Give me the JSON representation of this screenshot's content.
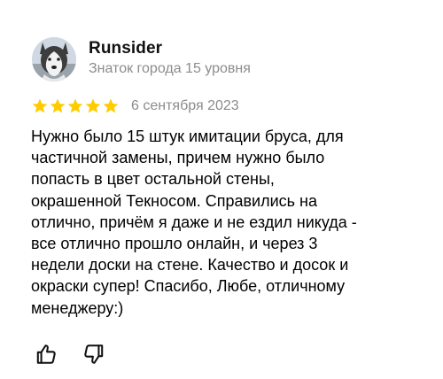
{
  "review": {
    "author": {
      "name": "Runsider",
      "level": "Знаток города 15 уровня",
      "avatar_icon": "husky-dog-avatar"
    },
    "rating": {
      "stars": 5,
      "max": 5,
      "star_color": "#ffcc00"
    },
    "date": "6 сентября 2023",
    "text": "Нужно было 15 штук имитации бруса, для\nчастичной замены, причем нужно было\nпопасть в цвет остальной стены,\nокрашенной Текносом. Справились на\nотлично, причём я даже и не ездил никуда -\nвсе отлично прошло онлайн, и через 3\nнедели доски на стене. Качество и досок и\nокраски супер! Спасибо, Любе, отличному\nменеджеру:)",
    "actions": {
      "like_icon": "thumbs-up-icon",
      "dislike_icon": "thumbs-down-icon"
    }
  },
  "colors": {
    "text": "#000000",
    "secondary_text": "#8c8c8c",
    "background": "#ffffff"
  }
}
